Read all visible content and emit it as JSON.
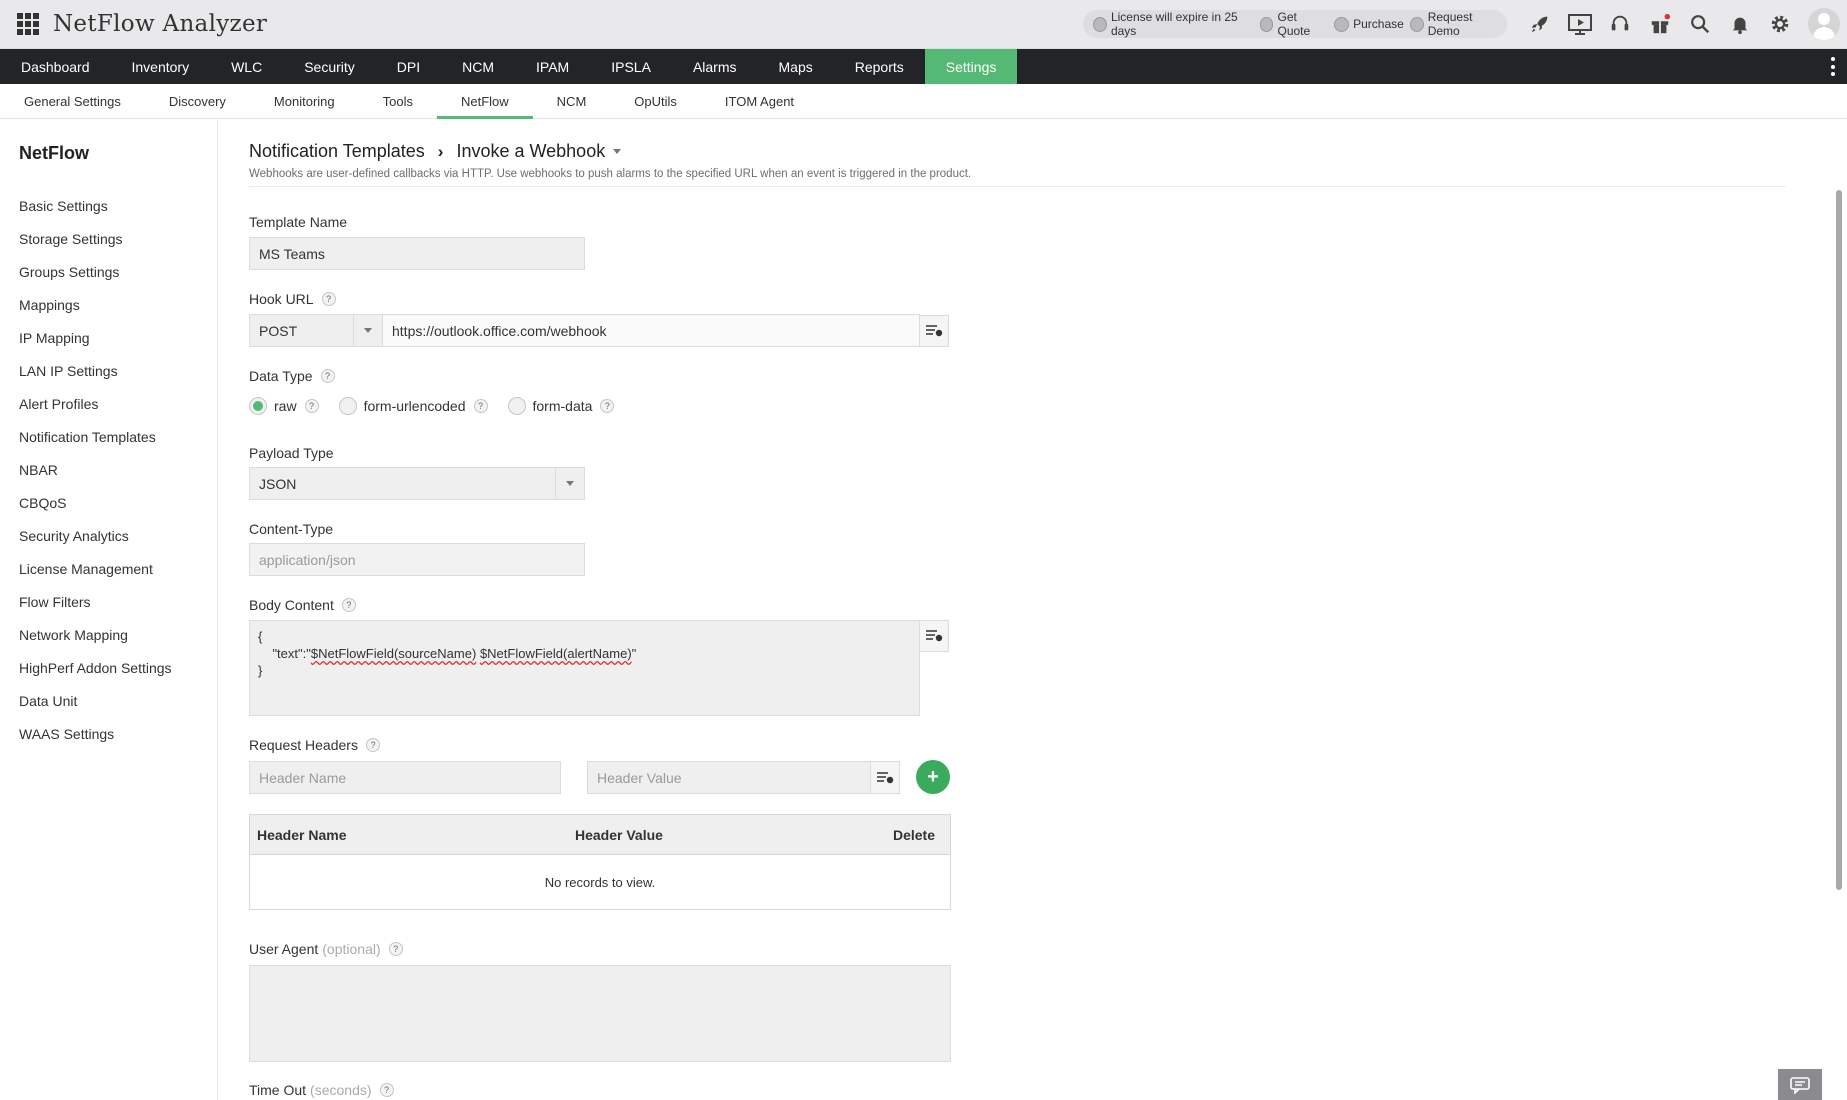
{
  "app": {
    "title": "NetFlow Analyzer"
  },
  "topbar": {
    "license_text": "License will expire in 25 days",
    "get_quote": "Get Quote",
    "purchase": "Purchase",
    "request_demo": "Request Demo",
    "icons": [
      "rocket-icon",
      "presentation-icon",
      "support-headset-icon",
      "gift-icon",
      "search-icon",
      "bell-icon",
      "gear-icon"
    ]
  },
  "main_nav": {
    "items": [
      "Dashboard",
      "Inventory",
      "WLC",
      "Security",
      "DPI",
      "NCM",
      "IPAM",
      "IPSLA",
      "Alarms",
      "Maps",
      "Reports",
      "Settings"
    ],
    "active": "Settings",
    "accent_color": "#54b974"
  },
  "sub_nav": {
    "items": [
      "General Settings",
      "Discovery",
      "Monitoring",
      "Tools",
      "NetFlow",
      "NCM",
      "OpUtils",
      "ITOM Agent"
    ],
    "active": "NetFlow"
  },
  "sidebar": {
    "title": "NetFlow",
    "items": [
      "Basic Settings",
      "Storage Settings",
      "Groups Settings",
      "Mappings",
      "IP Mapping",
      "LAN IP Settings",
      "Alert Profiles",
      "Notification Templates",
      "NBAR",
      "CBQoS",
      "Security Analytics",
      "License Management",
      "Flow Filters",
      "Network Mapping",
      "HighPerf Addon Settings",
      "Data Unit",
      "WAAS Settings"
    ]
  },
  "page": {
    "breadcrumb_parent": "Notification Templates",
    "breadcrumb_current": "Invoke a Webhook",
    "description": "Webhooks are user-defined callbacks via HTTP. Use webhooks to push alarms to the specified URL when an event is triggered in the product."
  },
  "form": {
    "template_name_label": "Template Name",
    "template_name_value": "MS Teams",
    "hook_url_label": "Hook URL",
    "hook_method": "POST",
    "hook_url_value": "https://outlook.office.com/webhook",
    "data_type_label": "Data Type",
    "data_type_options": [
      "raw",
      "form-urlencoded",
      "form-data"
    ],
    "data_type_selected": "raw",
    "payload_type_label": "Payload Type",
    "payload_type_value": "JSON",
    "content_type_label": "Content-Type",
    "content_type_placeholder": "application/json",
    "body_content_label": "Body Content",
    "body_line1": "{",
    "body_line2_prefix": "    \"text\":\"",
    "body_var1": "$NetFlowField(sourceName)",
    "body_var2": "$NetFlowField(alertName)",
    "body_line2_suffix": "\"",
    "body_line3": "}",
    "request_headers_label": "Request Headers",
    "header_name_placeholder": "Header Name",
    "header_value_placeholder": "Header Value",
    "add_symbol": "+",
    "table_columns": [
      "Header Name",
      "Header Value",
      "Delete"
    ],
    "table_empty": "No records to view.",
    "user_agent_label": "User Agent",
    "user_agent_optional": "(optional)",
    "timeout_label": "Time Out",
    "timeout_unit": "(seconds)",
    "help_symbol": "?"
  }
}
